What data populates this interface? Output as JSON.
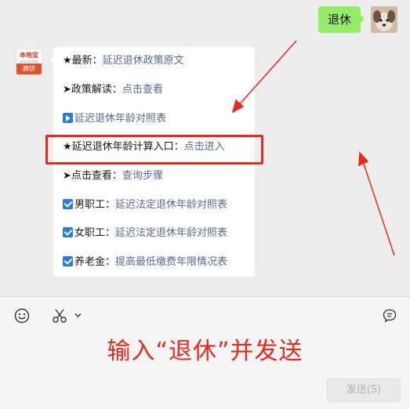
{
  "outgoing": {
    "text": "退休"
  },
  "bot": {
    "logo_text": "本地宝",
    "city": "廊坊"
  },
  "menu": [
    {
      "prefix": "★最新：",
      "link": "延迟退休政策原文",
      "icon": "star"
    },
    {
      "prefix": "➤政策解读：",
      "link": "点击查看",
      "icon": "arrow"
    },
    {
      "prefix": "",
      "link": "延迟退休年龄对照表",
      "icon": "play-box-icon"
    },
    {
      "prefix": "★延迟退休年龄计算入口：",
      "link": "点击进入",
      "icon": "star"
    },
    {
      "prefix": "➤点击查看：",
      "link": "查询步骤",
      "icon": "arrow"
    },
    {
      "prefix": "男职工：",
      "link": "延迟法定退休年龄对照表",
      "icon": "check-box-icon"
    },
    {
      "prefix": "女职工：",
      "link": "延迟法定退休年龄对照表",
      "icon": "check-box-icon"
    },
    {
      "prefix": "养老金：",
      "link": "提高最低缴费年限情况表",
      "icon": "check-box-icon"
    }
  ],
  "toolbar": {
    "icons": [
      "emoji-icon",
      "scissors-icon",
      "chevron-down-icon",
      "chat-bubble-icon"
    ]
  },
  "instruction": "输入“退休”并发送",
  "send_label": "发送(S)",
  "colors": {
    "outgoing_bubble": "#95ec69",
    "link": "#576b95",
    "highlight": "#e8291d",
    "accent_blue": "#2b7bd8"
  }
}
